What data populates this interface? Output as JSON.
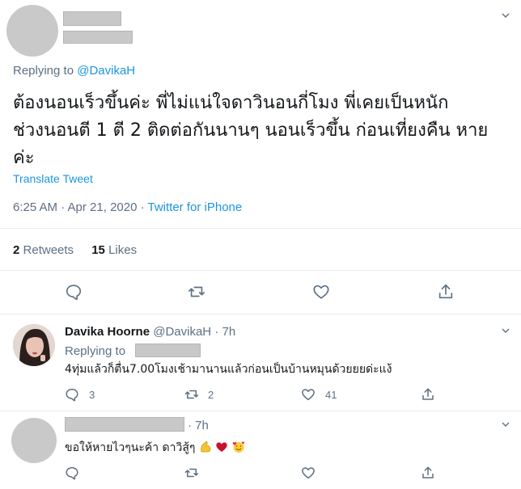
{
  "main_tweet": {
    "replying_prefix": "Replying to",
    "replying_handle": "@DavikaH",
    "text_line1": "ต้องนอนเร็วขึ้นค่ะ พี่ไม่แน่ใจดาวินอนกี่โมง พี่เคยเป็นหนัก",
    "text_line2": "ช่วงนอนตี 1 ตี 2 ติดต่อกันนานๆ นอนเร็วขึ้น ก่อนเที่ยงคืน หาย",
    "text_line3": "ค่ะ",
    "translate": "Translate Tweet",
    "time": "6:25 AM · Apr 21, 2020 · ",
    "source": "Twitter for iPhone",
    "retweets_count": "2",
    "retweets_label": "Retweets",
    "likes_count": "15",
    "likes_label": "Likes"
  },
  "reply1": {
    "name": "Davika Hoorne",
    "handle": "@DavikaH",
    "dot_time": "· 7h",
    "replying_prefix": "Replying to",
    "text": "4ทุ่มแล้วก็ตื่น7.00โมงเช้ามานานแล้วก่อนเป็นบ้านหมุนด้วยยยด่ะแง้",
    "replies": "3",
    "retweets": "2",
    "likes": "41"
  },
  "reply2": {
    "dot_time": "· 7h",
    "text": "ขอให้หายไวๆนะค้า ดาวิสู้ๆ"
  },
  "icons": {
    "reply": "reply-icon",
    "retweet": "retweet-icon",
    "like": "heart-icon",
    "share": "share-icon",
    "chevron": "chevron-down-icon"
  },
  "colors": {
    "link": "#1b95e0",
    "muted": "#5b7083",
    "separator": "#e6ecf0"
  }
}
